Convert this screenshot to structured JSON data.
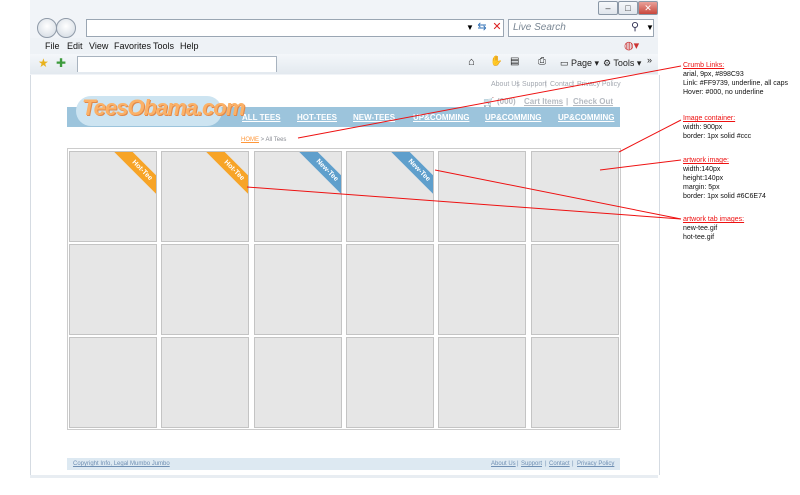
{
  "browser": {
    "window_buttons": [
      "–",
      "□",
      "✕"
    ],
    "search_placeholder": "Live Search",
    "menu": [
      "File",
      "Edit",
      "View",
      "Favorites",
      "Tools",
      "Help"
    ],
    "toolbar": {
      "page_label": "Page",
      "tools_label": "Tools"
    },
    "address_icons": [
      "go-icon",
      "stop-icon"
    ]
  },
  "site": {
    "logo": "TeesObama.com",
    "top_links": [
      "About Us",
      "|",
      "Support",
      "|",
      "Contact",
      "|",
      "Privacy Policy"
    ],
    "cart": {
      "count": "(000)",
      "cart_items": "Cart Items",
      "separator": "|",
      "checkout": "Check Out"
    },
    "nav": [
      "ALL TEES",
      "HOT-TEES",
      "NEW-TEES",
      "UP&COMMING",
      "UP&COMMING",
      "UP&COMMING"
    ],
    "crumb": {
      "home": "HOME",
      "sep": ">",
      "current": "All Tees"
    },
    "tiles": [
      {
        "badge": "Hot-Tee",
        "type": "hot"
      },
      {
        "badge": "Hot-Tee",
        "type": "hot"
      },
      {
        "badge": "New-Tee",
        "type": "new"
      },
      {
        "badge": "New-Tee",
        "type": "new"
      },
      {
        "badge": "",
        "type": ""
      },
      {
        "badge": "",
        "type": ""
      },
      {
        "badge": "",
        "type": ""
      },
      {
        "badge": "",
        "type": ""
      },
      {
        "badge": "",
        "type": ""
      },
      {
        "badge": "",
        "type": ""
      },
      {
        "badge": "",
        "type": ""
      },
      {
        "badge": "",
        "type": ""
      },
      {
        "badge": "",
        "type": ""
      },
      {
        "badge": "",
        "type": ""
      },
      {
        "badge": "",
        "type": ""
      },
      {
        "badge": "",
        "type": ""
      },
      {
        "badge": "",
        "type": ""
      },
      {
        "badge": "",
        "type": ""
      }
    ],
    "footer": {
      "copyright": "Copyright Info, Legal Mumbo Jumbo",
      "links": [
        "About Us",
        "|",
        "Support",
        "|",
        "Contact",
        "|",
        "Privacy Policy"
      ]
    }
  },
  "annotations": {
    "crumb": {
      "title": "Crumb Links:",
      "lines": [
        "arial, 9px, #898C93",
        "Link: #FF9739, underline, all caps",
        "Hover: #000, no underline"
      ]
    },
    "container": {
      "title": "Image container:",
      "lines": [
        "width: 900px",
        "border: 1px solid #ccc"
      ]
    },
    "artwork": {
      "title": "artwork image:",
      "lines": [
        "width:140px",
        "height:140px",
        "margin: 5px",
        "border: 1px solid #6C6E74"
      ]
    },
    "tabs": {
      "title": "artwork tab images:",
      "lines": [
        "new-tee.gif",
        "hot-tee.gif"
      ]
    }
  },
  "colors": {
    "hot": "#f7a427",
    "new": "#5f9fcc",
    "annotation_line": "#ee1111",
    "nav_bg": "#9cc4dc"
  }
}
